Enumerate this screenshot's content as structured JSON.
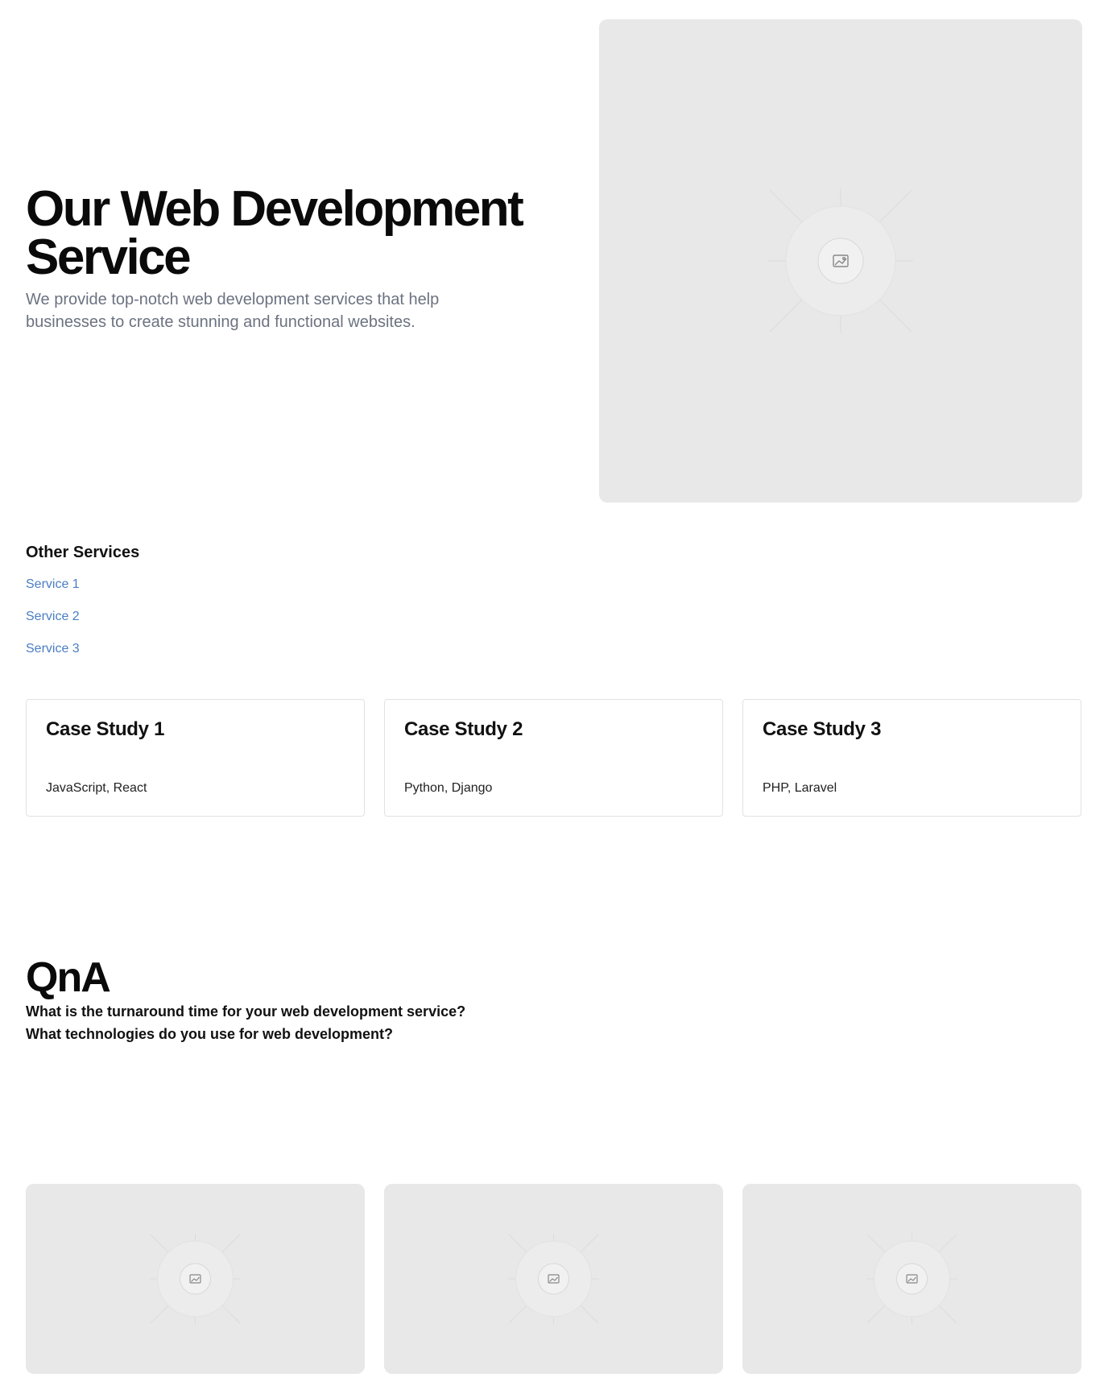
{
  "hero": {
    "title": "Our Web Development Service",
    "description": "We provide top-notch web development services that help businesses to create stunning and functional websites.",
    "image_icon": "image-placeholder-icon"
  },
  "other_services": {
    "title": "Other Services",
    "links": [
      "Service 1",
      "Service 2",
      "Service 3"
    ]
  },
  "case_studies": [
    {
      "title": "Case Study 1",
      "tech": "JavaScript, React"
    },
    {
      "title": "Case Study 2",
      "tech": "Python, Django"
    },
    {
      "title": "Case Study 3",
      "tech": "PHP, Laravel"
    }
  ],
  "qna": {
    "title": "QnA",
    "questions": [
      "What is the turnaround time for your web development service?",
      "What technologies do you use for web development?"
    ]
  },
  "gallery": {
    "item_icon": "image-placeholder-icon",
    "count": 3
  },
  "colors": {
    "link": "#4a7ec2",
    "placeholder_bg": "#e8e8e8",
    "muted_text": "#6b7280"
  }
}
